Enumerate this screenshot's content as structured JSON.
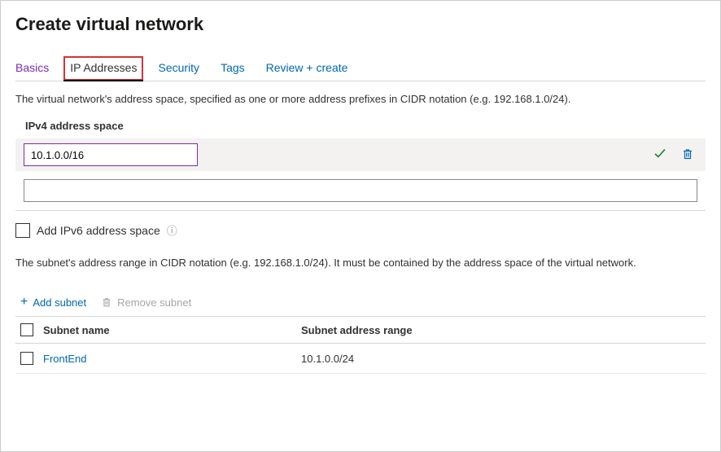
{
  "title": "Create virtual network",
  "tabs": {
    "basics": "Basics",
    "ip": "IP Addresses",
    "security": "Security",
    "tags": "Tags",
    "review": "Review + create"
  },
  "desc_top": "The virtual network's address space, specified as one or more address prefixes in CIDR notation (e.g. 192.168.1.0/24).",
  "ipv4_label": "IPv4 address space",
  "ipv4_value": "10.1.0.0/16",
  "ipv4_empty_value": "",
  "ipv6_checkbox_label": "Add IPv6 address space",
  "desc_subnets": "The subnet's address range in CIDR notation (e.g. 192.168.1.0/24). It must be contained by the address space of the virtual network.",
  "toolbar": {
    "add": "Add subnet",
    "remove": "Remove subnet"
  },
  "table": {
    "col1": "Subnet name",
    "col2": "Subnet address range",
    "rows": [
      {
        "name": "FrontEnd",
        "range": "10.1.0.0/24"
      }
    ]
  }
}
